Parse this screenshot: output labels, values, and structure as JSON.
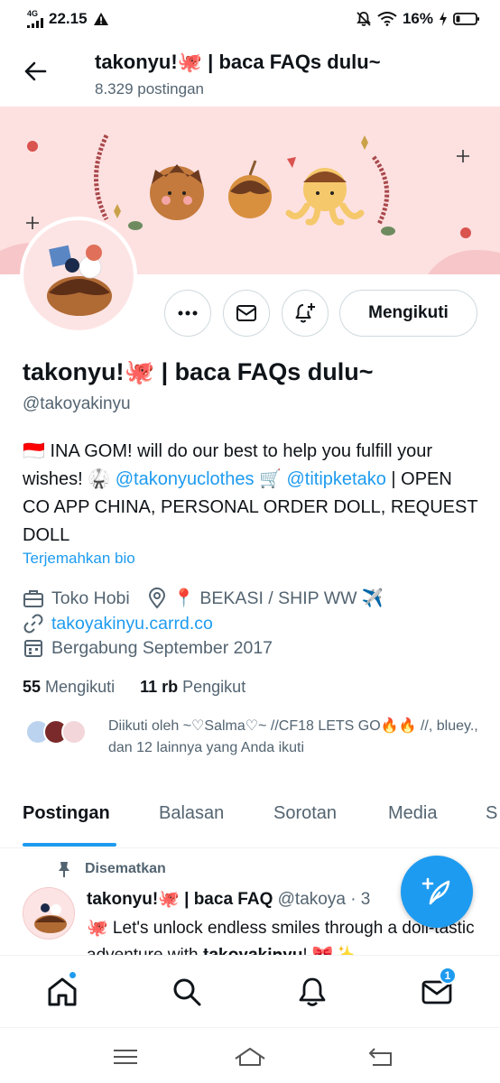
{
  "status_bar": {
    "network": "4G",
    "time": "22.15",
    "battery": "16%",
    "icons": [
      "signal-icon",
      "alert-icon",
      "mute-icon",
      "wifi-icon",
      "charging-icon",
      "battery-icon"
    ]
  },
  "header": {
    "title": "takonyu!🐙 | baca FAQs dulu~",
    "post_count": "8.329 postingan"
  },
  "actions": {
    "more": "more-icon",
    "message": "mail-icon",
    "notify": "bell-plus-icon",
    "follow_label": "Mengikuti"
  },
  "profile": {
    "name": "takonyu!🐙 | baca FAQs dulu~",
    "handle": "@takoyakinyu",
    "bio_intro": "🇮🇩 INA GOM! will do our best to help you fulfill your wishes! 🥋 ",
    "bio_link1": "@takonyuclothes",
    "bio_mid": " 🛒 ",
    "bio_link2": "@titipketako",
    "bio_tail": " | OPEN CO APP CHINA, PERSONAL ORDER DOLL, REQUEST DOLL",
    "translate": "Terjemahkan bio",
    "category": "Toko Hobi",
    "location": "📍 BEKASI / SHIP WW ✈️",
    "website": "takoyakinyu.carrd.co",
    "joined": "Bergabung September 2017"
  },
  "stats": {
    "following_count": "55",
    "following_label": "Mengikuti",
    "followers_count": "11 rb",
    "followers_label": "Pengikut"
  },
  "followed_by": "Diikuti oleh ~♡Salma♡~ //CF18 LETS GO🔥🔥 //, bluey., dan 12 lainnya yang Anda ikuti",
  "tabs": [
    "Postingan",
    "Balasan",
    "Sorotan",
    "Media",
    "S"
  ],
  "pinned_post": {
    "pinned_label": "Disematkan",
    "author": "takonyu!🐙 | baca FAQ",
    "handle": "@takoya",
    "separator": " · 3",
    "text": "🐙 Let's unlock endless smiles through a doll-tastic adventure with 𝐭𝐚𝐤𝐨𝐲𝐚𝐤𝐢𝐧𝐲𝐮! 🎀✨"
  },
  "bottom_nav": {
    "items": [
      "home-icon",
      "search-icon",
      "notifications-icon",
      "messages-icon"
    ],
    "messages_badge": "1"
  },
  "colors": {
    "accent": "#1d9bf0",
    "banner": "#fde1e1",
    "text": "#0f1419",
    "muted": "#536471"
  }
}
